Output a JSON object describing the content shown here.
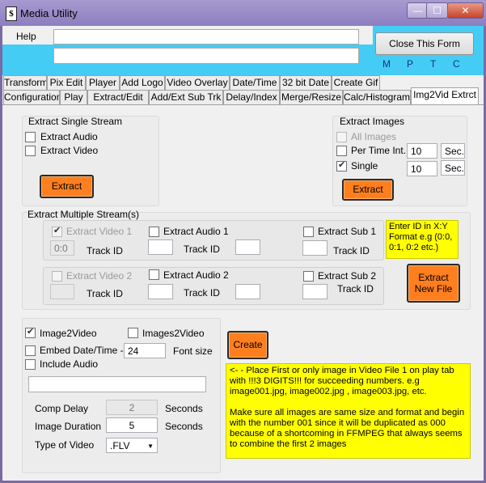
{
  "window": {
    "title": "Media Utility",
    "app_icon": "$",
    "controls": [
      "—",
      "☐",
      "✕"
    ]
  },
  "menu": {
    "help": "Help"
  },
  "header": {
    "close_label": "Close This Form",
    "mptc": [
      "M",
      "P",
      "T",
      "C"
    ]
  },
  "tabs_row1": [
    "Transform",
    "Pix Edit",
    "Player",
    "Add Logo",
    "Video Overlay",
    "Date/Time",
    "32 bit Date",
    "Create Gif"
  ],
  "tabs_row2": [
    "Configuration",
    "Play",
    "Extract/Edit",
    "Add/Ext Sub Trk",
    "Delay/Index",
    "Merge/Resize",
    "Calc/Histogram",
    "Img2Vid Extrct"
  ],
  "single": {
    "title": "Extract Single Stream",
    "extract_audio": "Extract Audio",
    "extract_video": "Extract Video",
    "extract_btn": "Extract"
  },
  "images": {
    "title": "Extract Images",
    "all_images": "All Images",
    "per_time": "Per Time Int.",
    "single": "Single",
    "per_time_value": "10",
    "single_value": "10",
    "per_time_unit": "Sec.",
    "single_unit": "Sec.",
    "extract_btn": "Extract"
  },
  "multi": {
    "title": "Extract Multiple Stream(s)",
    "video1": "Extract Video 1",
    "audio1": "Extract Audio 1",
    "sub1": "Extract Sub 1",
    "video2": "Extract Video 2",
    "audio2": "Extract Audio 2",
    "sub2": "Extract Sub 2",
    "track_id": "Track ID",
    "video1_value": "0:0",
    "note": "Enter ID in X:Y Format e.g (0:0, 0:1, 0:2 etc.)",
    "new_file_btn": "Extract New File"
  },
  "img2vid": {
    "image2video": "Image2Video",
    "images2video": "Images2Video",
    "embed": "Embed Date/Time ->",
    "font_value": "24",
    "font_size": "Font size",
    "include_audio": "Include Audio",
    "audio_path": "",
    "comp_delay": "Comp Delay",
    "comp_delay_value": "2",
    "seconds": "Seconds",
    "image_duration": "Image Duration",
    "image_duration_value": "5",
    "type_of_video": "Type of Video",
    "type_value": ".FLV",
    "create_btn": "Create",
    "instructions1": "<- - Place First or only image in Video File 1 on play tab with !!!3 DIGITS!!! for succeeding numbers. e.g image001.jpg, image002.jpg , image003.jpg, etc.",
    "instructions2": "Make sure all images are same size and format and begin with the number 001 since it will be duplicated as 000 because of a shortcoming in FFMPEG that always seems to combine the first 2 images"
  },
  "colors": {
    "accent_orange": "#ff7f1e",
    "cyan_band": "#45ccf5",
    "note_yellow": "#ffff00"
  }
}
